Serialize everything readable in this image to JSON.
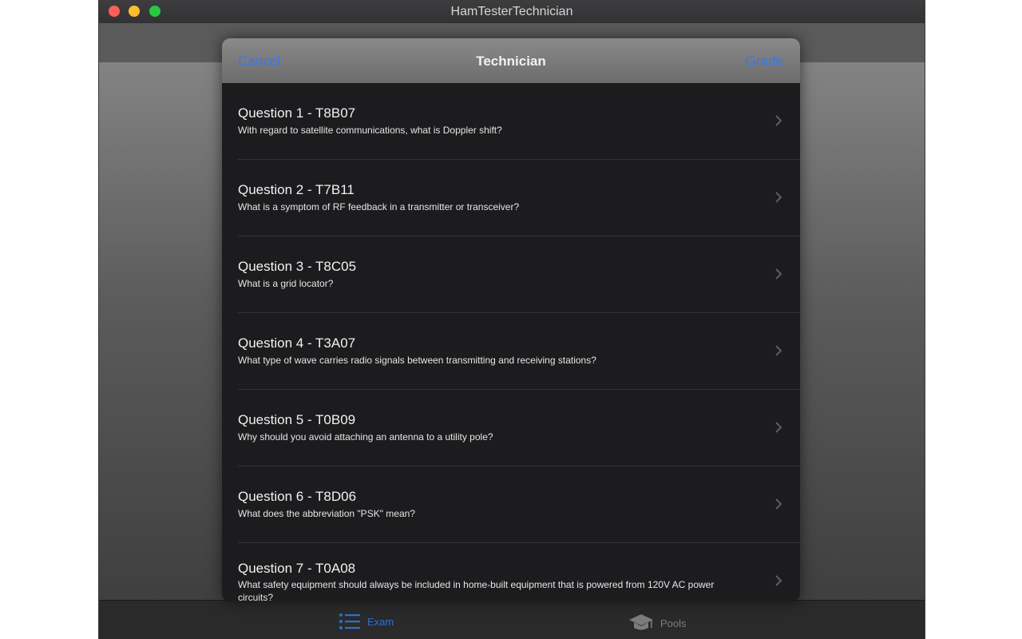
{
  "window": {
    "title": "HamTesterTechnician"
  },
  "modal": {
    "title": "Technician",
    "cancel_label": "Cancel",
    "grade_label": "Grade"
  },
  "questions": [
    {
      "title": "Question 1 - T8B07",
      "text": "With regard to satellite communications, what is Doppler shift?"
    },
    {
      "title": "Question 2 - T7B11",
      "text": "What is a symptom of RF feedback in a transmitter or transceiver?"
    },
    {
      "title": "Question 3 - T8C05",
      "text": "What is a grid locator?"
    },
    {
      "title": "Question 4 - T3A07",
      "text": "What type of wave carries radio signals between transmitting and receiving stations?"
    },
    {
      "title": "Question 5 - T0B09",
      "text": "Why should you avoid attaching an antenna to a utility pole?"
    },
    {
      "title": "Question 6 - T8D06",
      "text": "What does the abbreviation \"PSK\" mean?"
    },
    {
      "title": "Question 7 - T0A08",
      "text": "What safety equipment should always be included in home-built equipment that is powered from 120V AC power circuits?"
    }
  ],
  "tabs": [
    {
      "label": "Exam",
      "icon": "list-icon",
      "selected": true
    },
    {
      "label": "Pools",
      "icon": "graduation-cap-icon",
      "selected": false
    }
  ],
  "colors": {
    "accent": "#3478f6",
    "tab_selected": "#2f6fd1",
    "tab_unselected": "#7c7c7c"
  }
}
